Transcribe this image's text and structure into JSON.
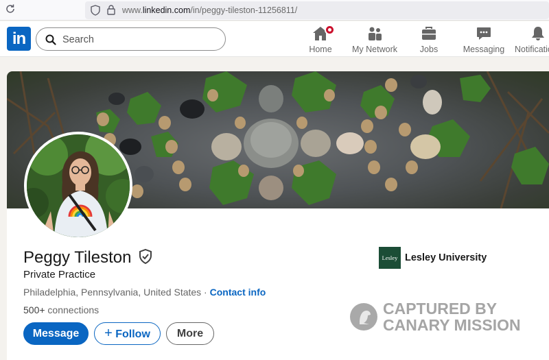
{
  "browser": {
    "url_prefix": "www.",
    "url_domain": "linkedin.com",
    "url_path": "/in/peggy-tileston-11256811/"
  },
  "nav": {
    "search_placeholder": "Search",
    "items": [
      {
        "label": "Home",
        "icon": "home-icon"
      },
      {
        "label": "My Network",
        "icon": "network-icon"
      },
      {
        "label": "Jobs",
        "icon": "briefcase-icon"
      },
      {
        "label": "Messaging",
        "icon": "chat-icon"
      },
      {
        "label": "Notifications",
        "icon": "bell-icon"
      }
    ],
    "logo_text": "in"
  },
  "profile": {
    "name": "Peggy Tileston",
    "headline": "Private Practice",
    "location": "Philadelphia, Pennsylvania, United States",
    "separator": " · ",
    "contact_info_label": "Contact info",
    "connections_count": "500+",
    "connections_label": " connections",
    "buttons": {
      "message": "Message",
      "follow": "Follow",
      "more": "More"
    },
    "organization": {
      "name": "Lesley University",
      "logo_text": "Lesley"
    }
  },
  "watermark": {
    "line1": "CAPTURED BY",
    "line2": "CANARY MISSION"
  },
  "colors": {
    "brand": "#0a66c2",
    "notification_badge": "#cb112d",
    "page_background": "#f4f2ee"
  }
}
